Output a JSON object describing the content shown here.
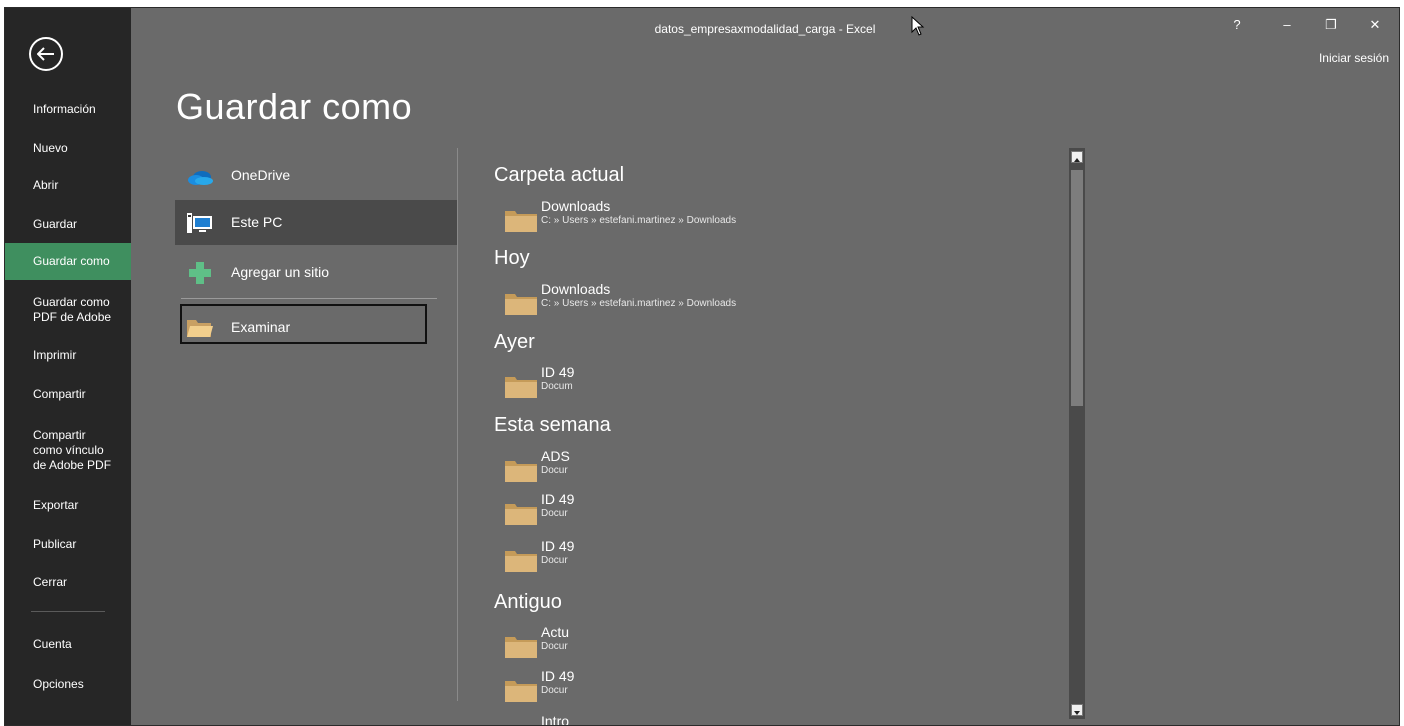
{
  "window": {
    "title": "datos_empresaxmodalidad_carga - Excel",
    "help": "?",
    "minimize": "–",
    "restore": "❐",
    "close": "✕",
    "sign_in": "Iniciar sesión"
  },
  "sidebar": {
    "back_icon": "back-arrow-icon",
    "items": [
      {
        "label": "Información"
      },
      {
        "label": "Nuevo"
      },
      {
        "label": "Abrir"
      },
      {
        "label": "Guardar"
      },
      {
        "label": "Guardar como"
      },
      {
        "label": "Guardar como PDF de Adobe"
      },
      {
        "label": "Imprimir"
      },
      {
        "label": "Compartir"
      },
      {
        "label": "Compartir como vínculo de Adobe PDF"
      },
      {
        "label": "Exportar"
      },
      {
        "label": "Publicar"
      },
      {
        "label": "Cerrar"
      },
      {
        "label": "Cuenta"
      },
      {
        "label": "Opciones"
      }
    ],
    "active": "Guardar como"
  },
  "main": {
    "title": "Guardar como",
    "locations": [
      {
        "label": "OneDrive",
        "icon": "onedrive-icon"
      },
      {
        "label": "Este PC",
        "icon": "computer-icon"
      },
      {
        "label": "Agregar un sitio",
        "icon": "add-place-icon"
      },
      {
        "label": "Examinar",
        "icon": "folder-icon"
      }
    ],
    "selected_location": "Este PC"
  },
  "recent": {
    "sections": [
      {
        "title": "Carpeta actual",
        "folders": [
          {
            "name": "Downloads",
            "path": "C: » Users » estefani.martinez » Downloads"
          }
        ]
      },
      {
        "title": "Hoy",
        "folders": [
          {
            "name": "Downloads",
            "path": "C: » Users » estefani.martinez » Downloads"
          }
        ]
      },
      {
        "title": "Ayer",
        "folders": [
          {
            "name": "ID 49",
            "path": "Docum"
          }
        ]
      },
      {
        "title": "Esta semana",
        "folders": [
          {
            "name": "ADS",
            "path": "Docur"
          },
          {
            "name": "ID 49",
            "path": "Docur"
          },
          {
            "name": "ID 49",
            "path": "Docur"
          }
        ]
      },
      {
        "title": "Antiguo",
        "folders": [
          {
            "name": "Actu",
            "path": "Docur"
          },
          {
            "name": "ID 49",
            "path": "Docur"
          },
          {
            "name": "Intro",
            "path": ""
          }
        ]
      }
    ]
  },
  "colors": {
    "sidebar_bg": "#262626",
    "main_bg": "#6a6a6a",
    "active_item": "#3f8f5f",
    "folder": "#dcb67a"
  }
}
